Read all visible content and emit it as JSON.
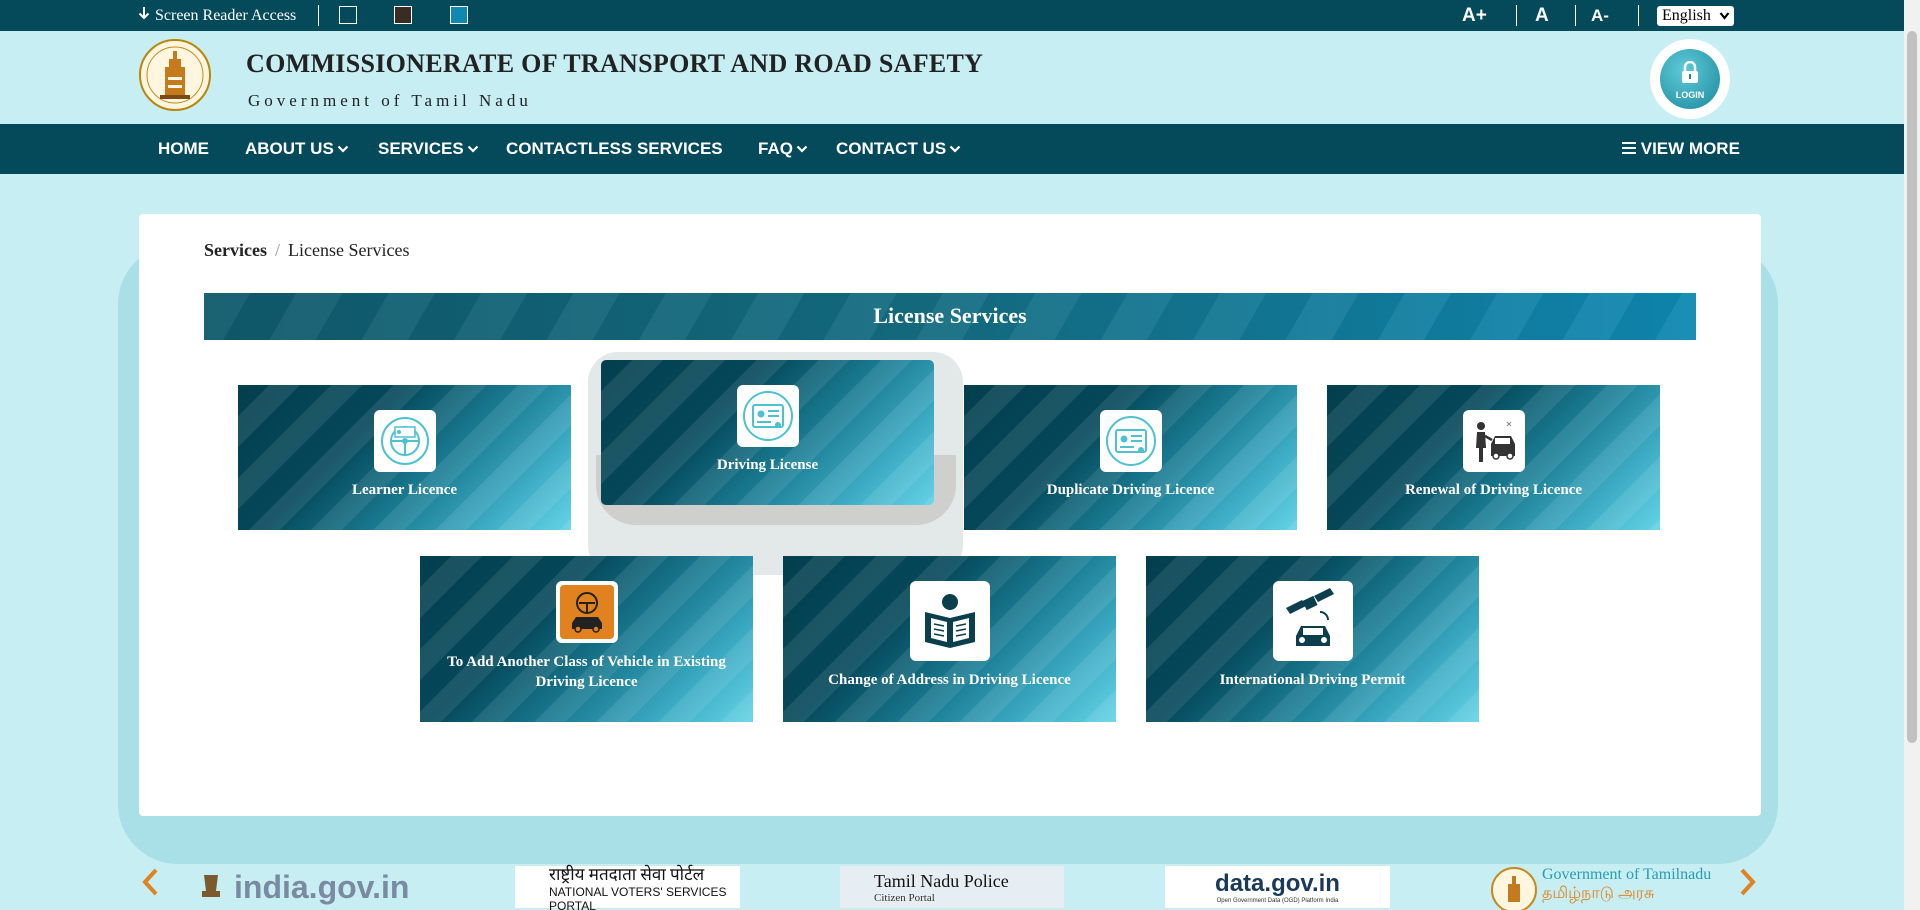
{
  "topbar": {
    "screen_reader": "Screen Reader Access",
    "font_increase": "A+",
    "font_normal": "A",
    "font_decrease": "A-",
    "language": "English",
    "swatches": [
      "#ffffff",
      "#3a2b24",
      "#0f88b2"
    ]
  },
  "header": {
    "title": "COMMISSIONERATE OF TRANSPORT AND ROAD SAFETY",
    "subtitle": "Government of Tamil Nadu",
    "login_label": "LOGIN"
  },
  "nav": {
    "items": [
      {
        "label": "HOME",
        "dropdown": false
      },
      {
        "label": "ABOUT US",
        "dropdown": true
      },
      {
        "label": "SERVICES",
        "dropdown": true
      },
      {
        "label": "CONTACTLESS SERVICES",
        "dropdown": false
      },
      {
        "label": "FAQ",
        "dropdown": true
      },
      {
        "label": "CONTACT US",
        "dropdown": true
      }
    ],
    "view_more": "VIEW MORE"
  },
  "breadcrumb": {
    "root": "Services",
    "separator": "/",
    "current": "License Services"
  },
  "section_title": "License Services",
  "tiles": [
    {
      "label": "Learner Licence",
      "icon": "steering-license-icon"
    },
    {
      "label": "Driving License",
      "icon": "license-card-icon"
    },
    {
      "label": "Duplicate Driving Licence",
      "icon": "license-card-icon"
    },
    {
      "label": "Renewal of Driving Licence",
      "icon": "person-car-icon"
    },
    {
      "label": "To Add Another Class of Vehicle in Existing Driving Licence",
      "icon": "vehicle-class-icon"
    },
    {
      "label": "Change of Address in Driving Licence",
      "icon": "newspaper-reader-icon"
    },
    {
      "label": "International Driving Permit",
      "icon": "satellite-car-icon"
    }
  ],
  "footer_logos": [
    {
      "name": "india.gov.in"
    },
    {
      "name": "राष्ट्रीय मतदाता सेवा पोर्टल",
      "sub": "NATIONAL VOTERS' SERVICES PORTAL"
    },
    {
      "name": "Tamil Nadu Police",
      "sub": "Citizen Portal"
    },
    {
      "name": "data.gov.in",
      "sub": "Open Government Data (OGD) Platform India"
    },
    {
      "name": "Government of Tamilnadu",
      "sub": "தமிழ்நாடு அரசு"
    }
  ],
  "colors": {
    "primary": "#044a5a",
    "background": "#c6eef3",
    "accent_arrow": "#e2821e"
  }
}
